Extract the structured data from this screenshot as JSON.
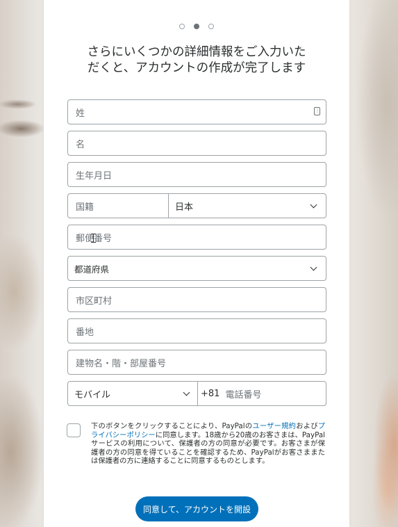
{
  "steps": {
    "total": 3,
    "active": 2
  },
  "title_line1": "さらにいくつかの詳細情報をご入力いた",
  "title_line2": "だくと、アカウントの作成が完了します",
  "fields": {
    "last_name": "姓",
    "first_name": "名",
    "birthdate": "生年月日",
    "nationality_label": "国籍",
    "nationality_value": "日本",
    "postal_code": "郵便番号",
    "prefecture": "都道府県",
    "city": "市区町村",
    "address": "番地",
    "building": "建物名・階・部屋番号",
    "phone_type": "モバイル",
    "phone_prefix": "+81",
    "phone_number": "電話番号"
  },
  "consent": {
    "text_1": "下のボタンをクリックすることにより、PayPalの",
    "link_1": "ユーザー規約",
    "text_2": "および",
    "link_2": "プライバシーポリシー",
    "text_3": "に同意します。18歳から20歳のお客さまは、PayPalサービスの利用について、保護者の方の同意が必要です。お客さまが保護者の方の同意を得ていることを確認するため、PayPalがお客さままたは保護者の方に連絡することに同意するものとします。"
  },
  "submit_label": "同意して、アカウントを開設",
  "colors": {
    "accent": "#0070ba",
    "border": "#9da3a6",
    "text": "#2c2e2f"
  }
}
